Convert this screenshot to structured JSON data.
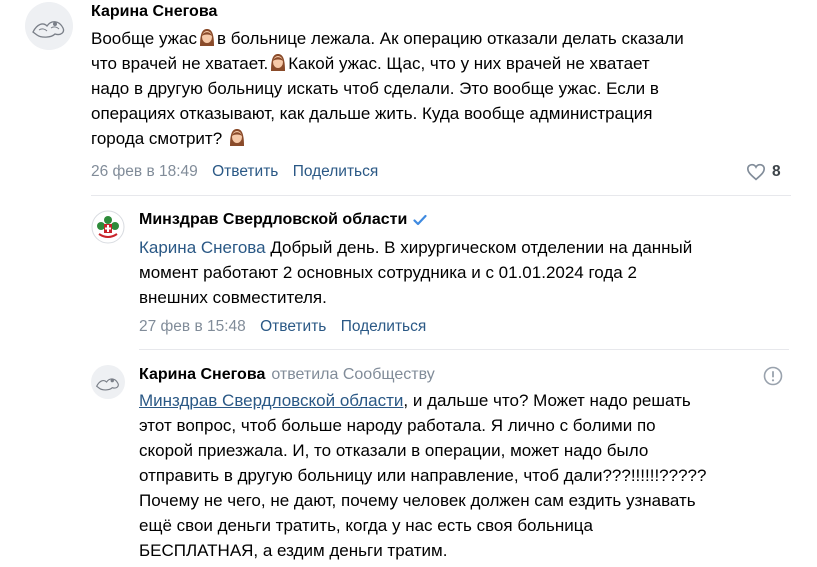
{
  "comments": [
    {
      "author": "Карина Снегова",
      "lines": [
        [
          "Вообще ужас",
          "в больнице лежала. Ак операцию отказали делать сказали"
        ],
        [
          "что врачей не хватает.",
          "Какой ужас. Щас, что у них врачей не хватает"
        ],
        [
          "надо в другую больницу искать чтоб сделали. Это вообще ужас. Если в"
        ],
        [
          "операциях отказывают, как дальше жить. Куда вообще администрация"
        ],
        [
          "города смотрит?"
        ]
      ],
      "date": "26 фев в 18:49",
      "reply_label": "Ответить",
      "share_label": "Поделиться",
      "likes": "8"
    },
    {
      "author": "Минздрав Свердловской области",
      "mention": "Карина Снегова",
      "lines": [
        "Добрый день. В хирургическом отделении на данный",
        "момент работают 2 основных сотрудника и с 01.01.2024 года 2",
        "внешних совместителя."
      ],
      "date": "27 фев в 15:48",
      "reply_label": "Ответить",
      "share_label": "Поделиться"
    },
    {
      "author": "Карина Снегова",
      "replied_to": "ответила Сообществу",
      "mention": "Минздрав Свердловской области",
      "lines": [
        ", и дальше что? Может надо решать",
        "этот вопрос, чтоб больше народу работала. Я лично с болими по",
        "скорой приезжала. И, то отказали в операции, может надо было",
        "отправить в другую больницу или направление, чтоб дали???!!!!!!?????",
        "Почему не чего, не дают, почему человек должен сам ездить узнавать",
        "ещё свои деньги тратить, когда у нас есть своя больница",
        "БЕСПЛАТНАЯ, а ездим деньги тратим."
      ]
    }
  ],
  "colors": {
    "link": "#2a5885",
    "meta": "#818c99",
    "verified": "#3f8ae0",
    "divider": "#e7e8ec"
  }
}
